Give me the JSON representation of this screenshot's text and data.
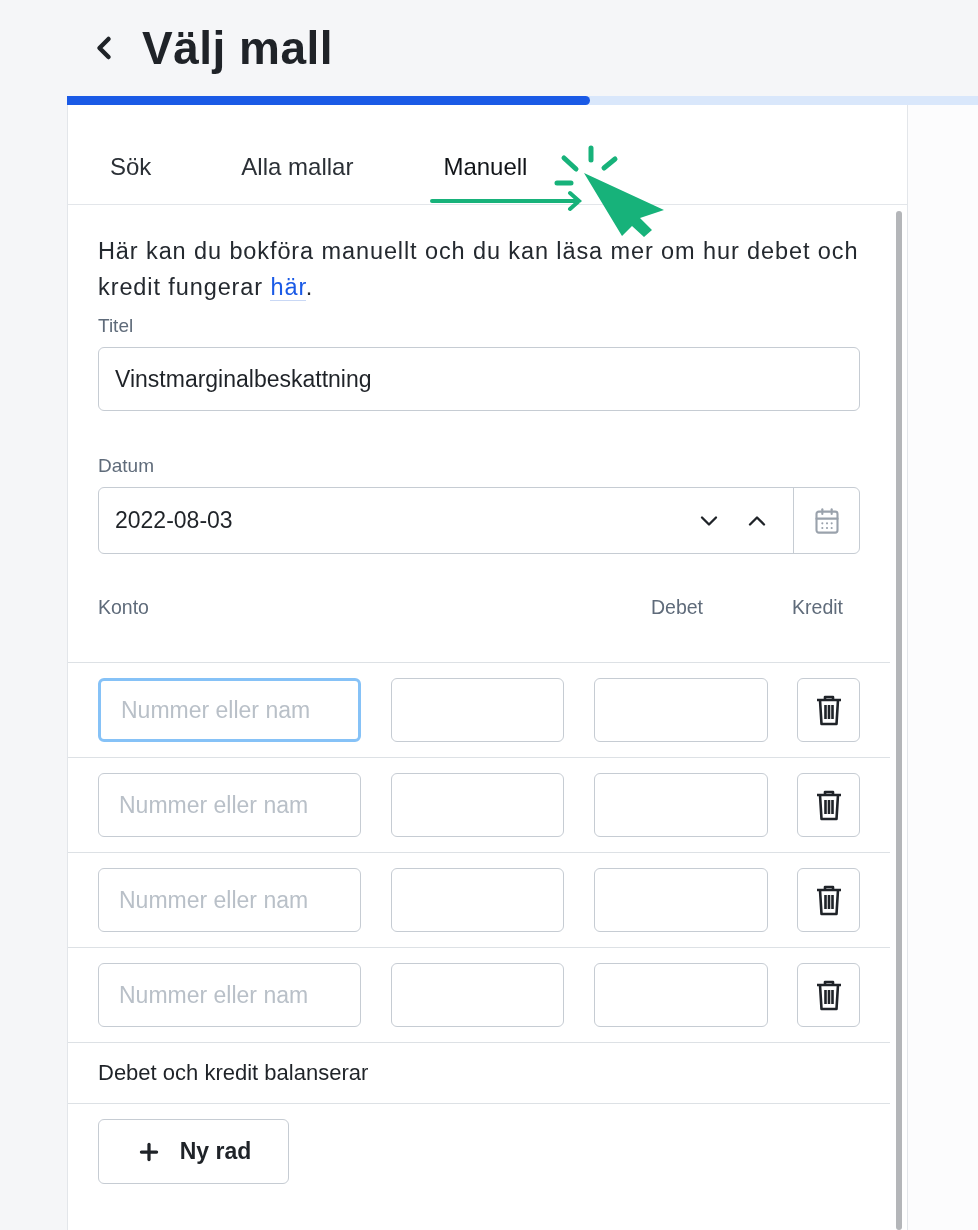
{
  "header": {
    "title": "Välj mall"
  },
  "progress": {
    "level": 0.574
  },
  "tabs": [
    {
      "label": "Sök",
      "selected": false
    },
    {
      "label": "Alla mallar",
      "selected": false
    },
    {
      "label": "Manuell",
      "selected": true
    }
  ],
  "intro": {
    "text": "Här kan du bokföra manuellt och du kan läsa mer om hur debet och kredit fungerar ",
    "link": "här",
    "end": "."
  },
  "title_field": {
    "label": "Titel",
    "value": "Vinstmarginalbeskattning"
  },
  "date_field": {
    "label": "Datum",
    "value": "2022-08-03"
  },
  "columns": [
    "Konto",
    "Debet",
    "Kredit"
  ],
  "rows": [
    {
      "placeholder": "Nummer eller nam",
      "focused": true
    },
    {
      "placeholder": "Nummer eller nam",
      "focused": false
    },
    {
      "placeholder": "Nummer eller nam",
      "focused": false
    },
    {
      "placeholder": "Nummer eller nam",
      "focused": false
    }
  ],
  "status": "Debet och kredit balanserar",
  "add_button": {
    "label": "Ny rad"
  }
}
